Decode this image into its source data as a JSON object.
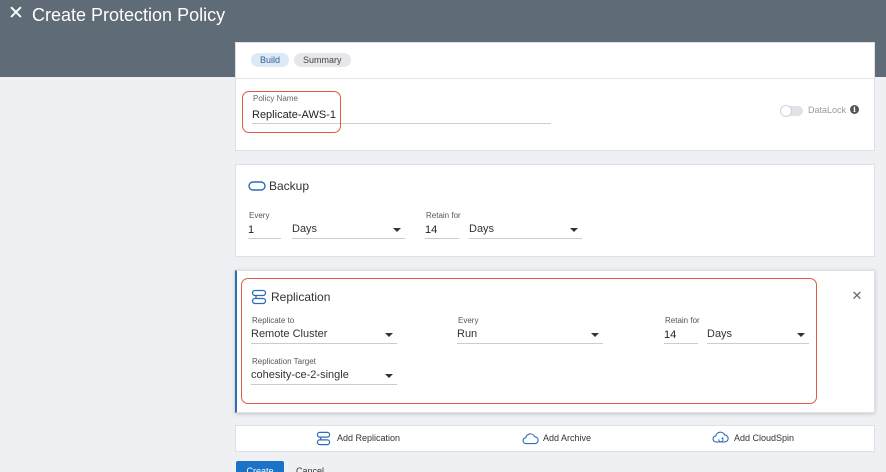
{
  "header": {
    "title": "Create Protection Policy",
    "close_icon": "close-icon"
  },
  "tabs": [
    {
      "label": "Build",
      "active": true
    },
    {
      "label": "Summary",
      "active": false
    }
  ],
  "policy": {
    "name_label": "Policy Name",
    "name_value": "Replicate-AWS-1",
    "datalock_label": "DataLock",
    "datalock_enabled": false,
    "info_icon": "i"
  },
  "backup": {
    "title": "Backup",
    "every_label": "Every",
    "every_value": "1",
    "every_unit": "Days",
    "retain_label": "Retain for",
    "retain_value": "14",
    "retain_unit": "Days"
  },
  "replication": {
    "title": "Replication",
    "replicate_to_label": "Replicate to",
    "replicate_to_value": "Remote Cluster",
    "every_label": "Every",
    "every_value": "Run",
    "retain_label": "Retain for",
    "retain_value": "14",
    "retain_unit": "Days",
    "target_label": "Replication Target",
    "target_value": "cohesity-ce-2-single"
  },
  "actions": {
    "add_replication": "Add Replication",
    "add_archive": "Add Archive",
    "add_cloudspin": "Add CloudSpin"
  },
  "footer": {
    "create_label": "Create",
    "cancel_label": "Cancel"
  },
  "colors": {
    "header_bg": "#5f6c78",
    "highlight": "#e05a44",
    "primary": "#1a73c7",
    "icon_blue": "#2d6db5"
  }
}
